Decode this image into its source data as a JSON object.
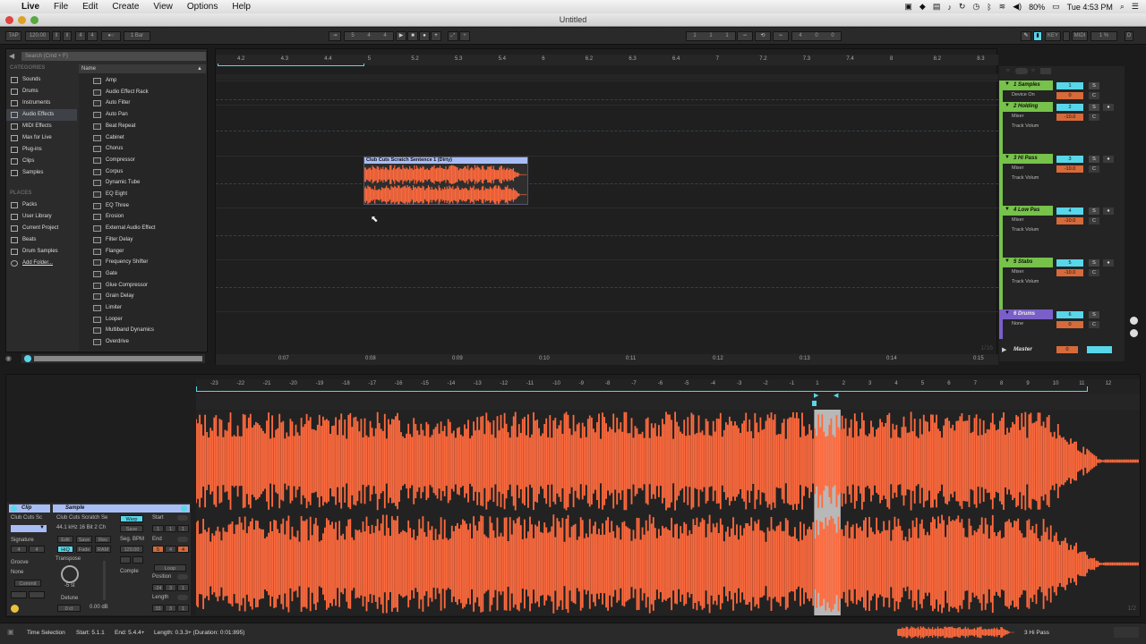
{
  "menubar": {
    "apple": "",
    "app": "Live",
    "items": [
      "File",
      "Edit",
      "Create",
      "View",
      "Options",
      "Help"
    ],
    "battery": "80%",
    "clock": "Tue 4:53 PM"
  },
  "window": {
    "title": "Untitled"
  },
  "transport": {
    "tap": "TAP",
    "tempo": "120.00",
    "sig_num": "4",
    "sig_den": "4",
    "quant": "1 Bar",
    "pos_bar": "5",
    "pos_beat": "4",
    "pos_sixteenth": "4",
    "loop_start": "1",
    "loop_start_b": "1",
    "loop_start_c": "1",
    "loop_len": "4",
    "loop_len_b": "0",
    "loop_len_c": "0",
    "key": "KEY",
    "midi": "MIDI",
    "cpu": "1 %",
    "d": "D"
  },
  "browser": {
    "search_placeholder": "Search (Cmd + F)",
    "categories_header": "CATEGORIES",
    "categories": [
      "Sounds",
      "Drums",
      "Instruments",
      "Audio Effects",
      "MIDI Effects",
      "Max for Live",
      "Plug-ins",
      "Clips",
      "Samples"
    ],
    "places_header": "PLACES",
    "places": [
      "Packs",
      "User Library",
      "Current Project",
      "Beats",
      "Drum Samples",
      "Add Folder..."
    ],
    "name_header": "Name",
    "devices": [
      "Amp",
      "Audio Effect Rack",
      "Auto Filter",
      "Auto Pan",
      "Beat Repeat",
      "Cabinet",
      "Chorus",
      "Compressor",
      "Corpus",
      "Dynamic Tube",
      "EQ Eight",
      "EQ Three",
      "Erosion",
      "External Audio Effect",
      "Filter Delay",
      "Flanger",
      "Frequency Shifter",
      "Gate",
      "Glue Compressor",
      "Grain Delay",
      "Limiter",
      "Looper",
      "Multiband Dynamics",
      "Overdrive"
    ]
  },
  "arrangement": {
    "ruler_top": [
      "4.2",
      "4.3",
      "4.4",
      "5",
      "5.2",
      "5.3",
      "5.4",
      "6",
      "6.2",
      "6.3",
      "6.4",
      "7",
      "7.2",
      "7.3",
      "7.4",
      "8",
      "8.2",
      "8.3"
    ],
    "ruler_time": [
      "0:07",
      "0:08",
      "0:09",
      "0:10",
      "0:11",
      "0:12",
      "0:13",
      "0:14",
      "0:15"
    ],
    "clip_name": "Club Cuts Scratch Sentence 1 (Dirty)",
    "zoom_label": "1/16"
  },
  "mixer": {
    "tracks": [
      {
        "name": "1 Samples",
        "sub1": "Device On",
        "num": "1",
        "vol": "0",
        "s": "S",
        "c": "C",
        "color": "#76c24a"
      },
      {
        "name": "2 Holding",
        "sub1": "Mixer",
        "sub2": "Track Volum",
        "num": "2",
        "vol": "-10.0",
        "s": "S",
        "c": "C",
        "color": "#76c24a"
      },
      {
        "name": "3 Hi Pass",
        "sub1": "Mixer",
        "sub2": "Track Volum",
        "num": "3",
        "vol": "-10.0",
        "s": "S",
        "c": "C",
        "color": "#76c24a"
      },
      {
        "name": "4 Low Pas",
        "sub1": "Mixer",
        "sub2": "Track Volum",
        "num": "4",
        "vol": "-10.0",
        "s": "S",
        "c": "C",
        "color": "#76c24a"
      },
      {
        "name": "5 Stabs",
        "sub1": "Mixer",
        "sub2": "Track Volum",
        "num": "5",
        "vol": "-10.0",
        "s": "S",
        "c": "C",
        "color": "#76c24a"
      },
      {
        "name": "6 Drums",
        "sub1": "None",
        "num": "6",
        "vol": "0",
        "s": "S",
        "c": "C",
        "color": "#7a5fc8"
      }
    ],
    "master": "Master",
    "master_vol": "0"
  },
  "detail": {
    "ruler": [
      "-23",
      "-22",
      "-21",
      "-20",
      "-19",
      "-18",
      "-17",
      "-16",
      "-15",
      "-14",
      "-13",
      "-12",
      "-11",
      "-10",
      "-9",
      "-8",
      "-7",
      "-6",
      "-5",
      "-4",
      "-3",
      "-2",
      "-1",
      "1",
      "2",
      "3",
      "4",
      "5",
      "6",
      "7",
      "8",
      "9",
      "10",
      "11",
      "12"
    ],
    "clip_section": "Clip",
    "clip_name": "Club Cuts Sc",
    "signature_label": "Signature",
    "sig_num": "4",
    "sig_den": "4",
    "groove_label": "Groove",
    "groove_val": "None",
    "commit": "Commit",
    "sample_section": "Sample",
    "sample_name": "Club Cuts Scratch Se",
    "sample_info": "44.1 kHz 16 Bit 2 Ch",
    "edit": "Edit",
    "save": "Save",
    "rev": "Rev",
    "hiq": "HiQ",
    "fade": "Fade",
    "ram": "RAM",
    "transpose_label": "Transpose",
    "transpose_val": "-5 st",
    "detune_label": "Detune",
    "detune_val": "0 ct",
    "gain_val": "0.00 dB",
    "warp": "Warp",
    "seg_bpm_label": "Seg. BPM",
    "seg_bpm": "120.00",
    "complex": "Comple",
    "start_label": "Start",
    "start": [
      "1",
      "1",
      "1"
    ],
    "end_label": "End",
    "end": [
      "5",
      "4",
      "4"
    ],
    "loop_btn": "Loop",
    "position_label": "Position",
    "position": [
      "-24",
      "3",
      "1"
    ],
    "length_label": "Length",
    "length": [
      "33",
      "3",
      "1"
    ],
    "zoom": "1/2"
  },
  "statusbar": {
    "mode": "Time Selection",
    "start": "Start: 5.1.1",
    "end": "End: 5.4.4+",
    "length": "Length: 0.3.3+ (Duration: 0:01:895)",
    "track": "3 Hi Pass"
  },
  "colors": {
    "clip_header": "#a9bdf5",
    "waveform": "#ff6a3d",
    "green": "#76c24a",
    "purple": "#7a5fc8",
    "cyan": "#58d6ea",
    "orange": "#d66a3a"
  }
}
